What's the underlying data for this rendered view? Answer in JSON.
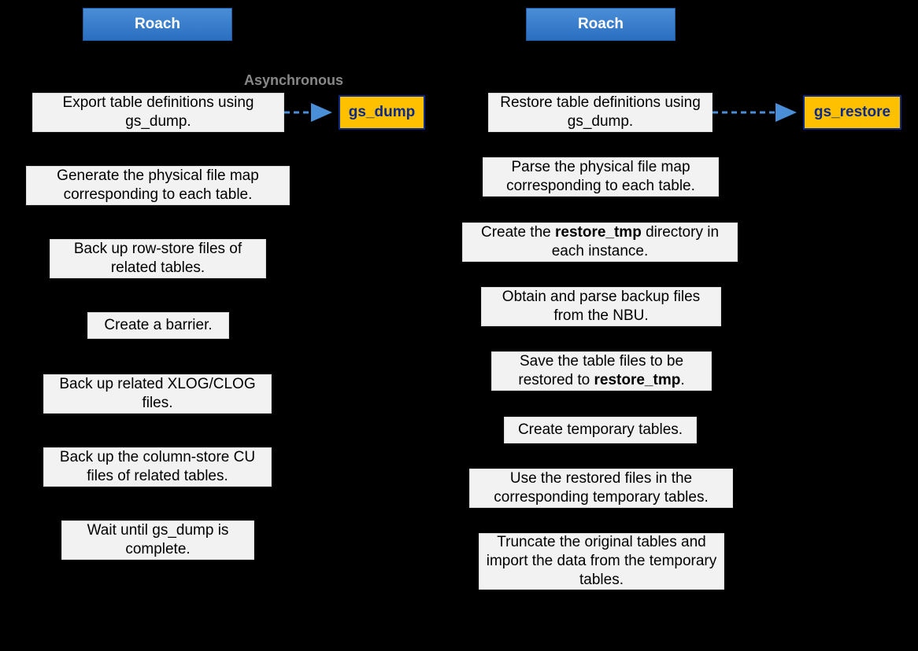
{
  "left": {
    "header": "Roach",
    "asyncLabel": "Asynchronous",
    "call": "gs_dump",
    "steps": [
      "Export  table definitions using gs_dump.",
      "Generate the physical file map corresponding to each table.",
      "Back up row-store files of related tables.",
      "Create a barrier.",
      "Back up related XLOG/CLOG files.",
      "Back up the column-store CU files of related tables.",
      "Wait until gs_dump is complete."
    ]
  },
  "right": {
    "header": "Roach",
    "call": "gs_restore",
    "steps": [
      "Restore table definitions using gs_dump.",
      "Parse the physical file map corresponding to each table.",
      "Create the restore_tmp directory in each instance.",
      "Obtain and parse backup files from the NBU.",
      "Save the table files to be restored to restore_tmp.",
      "Create temporary tables.",
      "Use the restored files in the corresponding temporary tables.",
      "Truncate the original tables and import the data from the temporary tables."
    ],
    "boldTokens": [
      "restore_tmp"
    ]
  }
}
